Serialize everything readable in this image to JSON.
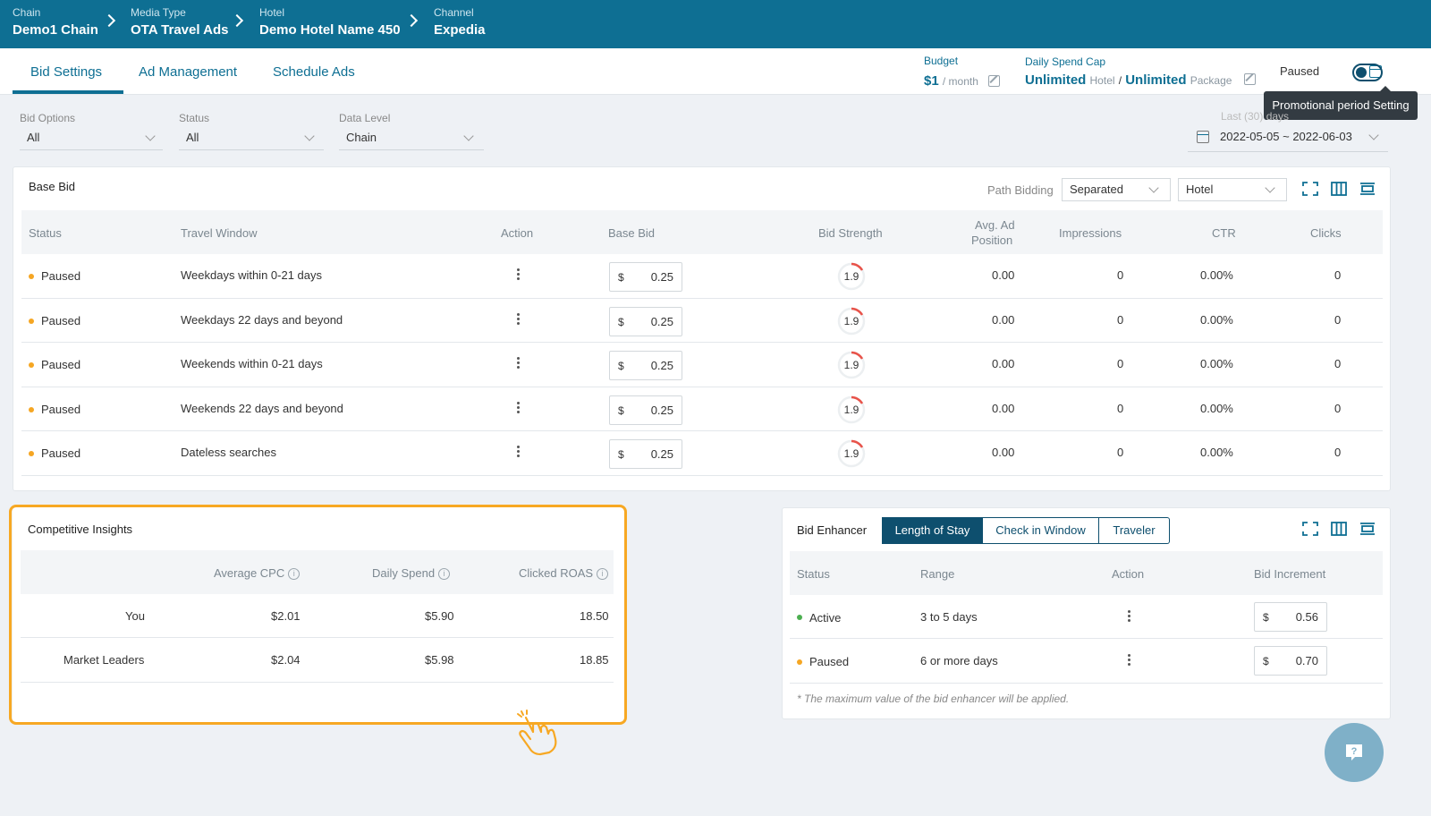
{
  "breadcrumb": [
    {
      "label": "Chain",
      "value": "Demo1 Chain"
    },
    {
      "label": "Media Type",
      "value": "OTA Travel Ads"
    },
    {
      "label": "Hotel",
      "value": "Demo Hotel Name 450"
    },
    {
      "label": "Channel",
      "value": "Expedia"
    }
  ],
  "tabs": [
    "Bid Settings",
    "Ad Management",
    "Schedule Ads"
  ],
  "budget": {
    "label": "Budget",
    "value": "$1",
    "unit": "/ month"
  },
  "daily_spend_cap": {
    "label": "Daily Spend Cap",
    "hotel_value": "Unlimited",
    "hotel_unit": "Hotel",
    "separator": "/",
    "package_value": "Unlimited",
    "package_unit": "Package"
  },
  "status_toggle": {
    "label": "Paused"
  },
  "tooltip": "Promotional period Setting",
  "filters": {
    "bid_options": {
      "label": "Bid Options",
      "value": "All"
    },
    "status": {
      "label": "Status",
      "value": "All"
    },
    "data_level": {
      "label": "Data Level",
      "value": "Chain"
    },
    "date": {
      "label": "Last (30) days",
      "value": "2022-05-05 ~ 2022-06-03"
    }
  },
  "base_bid": {
    "title": "Base Bid",
    "path_bidding_label": "Path Bidding",
    "path_bidding_value": "Separated",
    "scope_value": "Hotel",
    "columns": [
      "Status",
      "Travel Window",
      "Action",
      "Base Bid",
      "Bid Strength",
      "Avg. Ad",
      "Position",
      "Impressions",
      "CTR",
      "Clicks"
    ],
    "rows": [
      {
        "status": "Paused",
        "window": "Weekdays within 0-21 days",
        "currency": "$",
        "bid": "0.25",
        "strength": "1.9",
        "avg_pos": "0.00",
        "impressions": "0",
        "ctr": "0.00%",
        "clicks": "0"
      },
      {
        "status": "Paused",
        "window": "Weekdays 22 days and beyond",
        "currency": "$",
        "bid": "0.25",
        "strength": "1.9",
        "avg_pos": "0.00",
        "impressions": "0",
        "ctr": "0.00%",
        "clicks": "0"
      },
      {
        "status": "Paused",
        "window": "Weekends within 0-21 days",
        "currency": "$",
        "bid": "0.25",
        "strength": "1.9",
        "avg_pos": "0.00",
        "impressions": "0",
        "ctr": "0.00%",
        "clicks": "0"
      },
      {
        "status": "Paused",
        "window": "Weekends 22 days and beyond",
        "currency": "$",
        "bid": "0.25",
        "strength": "1.9",
        "avg_pos": "0.00",
        "impressions": "0",
        "ctr": "0.00%",
        "clicks": "0"
      },
      {
        "status": "Paused",
        "window": "Dateless searches",
        "currency": "$",
        "bid": "0.25",
        "strength": "1.9",
        "avg_pos": "0.00",
        "impressions": "0",
        "ctr": "0.00%",
        "clicks": "0"
      }
    ]
  },
  "competitive": {
    "title": "Competitive Insights",
    "columns": [
      "Average CPC",
      "Daily Spend",
      "Clicked ROAS"
    ],
    "rows": [
      {
        "name": "You",
        "cpc": "$2.01",
        "spend": "$5.90",
        "roas": "18.50"
      },
      {
        "name": "Market Leaders",
        "cpc": "$2.04",
        "spend": "$5.98",
        "roas": "18.85"
      }
    ]
  },
  "bid_enhancer": {
    "title": "Bid Enhancer",
    "segments": [
      "Length of Stay",
      "Check in Window",
      "Traveler"
    ],
    "columns": [
      "Status",
      "Range",
      "Action",
      "Bid Increment"
    ],
    "rows": [
      {
        "status": "Active",
        "range": "3 to 5 days",
        "currency": "$",
        "value": "0.56"
      },
      {
        "status": "Paused",
        "range": "6 or more days",
        "currency": "$",
        "value": "0.70"
      }
    ],
    "note": "* The maximum value of the bid enhancer will be applied."
  },
  "colors": {
    "brand": "#0e6f93",
    "paused": "#f5a623",
    "active": "#4caf50",
    "highlight": "#f7a823",
    "strength_arc": "#e8534a"
  },
  "icons": [
    "chevron-right-icon",
    "edit-icon",
    "calendar-icon",
    "fullscreen-icon",
    "columns-icon",
    "density-icon",
    "info-icon",
    "kebab-icon",
    "hand-pointer-icon",
    "help-icon"
  ]
}
